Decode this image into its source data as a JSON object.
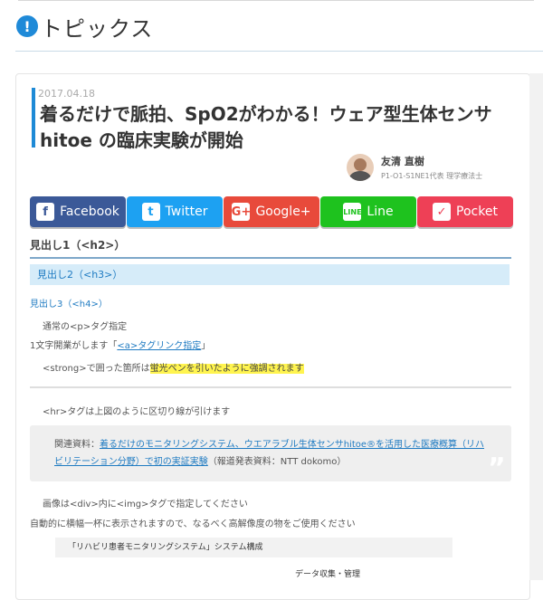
{
  "section": {
    "icon": "exclamation-icon",
    "icon_glyph": "!",
    "title": "トピックス"
  },
  "article": {
    "date": "2017.04.18",
    "title": "着るだけで脈拍、SpO2がわかる！ウェア型生体センサhitoe の臨床実験が開始",
    "author": {
      "name": "友清 直樹",
      "role": "P1-O1-S1NE1代表 理学療法士"
    }
  },
  "share": [
    {
      "label": "Facebook",
      "icon": "facebook-icon",
      "glyph": "f"
    },
    {
      "label": "Twitter",
      "icon": "twitter-icon",
      "glyph": "t"
    },
    {
      "label": "Google+",
      "icon": "google-plus-icon",
      "glyph": "G+"
    },
    {
      "label": "Line",
      "icon": "line-icon",
      "glyph": "LINE"
    },
    {
      "label": "Pocket",
      "icon": "pocket-icon",
      "glyph": "✓"
    }
  ],
  "body": {
    "h2": "見出し1（<h2>）",
    "h3": "見出し2（<h3>）",
    "h4": "見出し3（<h4>）",
    "p1": "通常の<p>タグ指定",
    "p2_prefix": "1文字開業がします「",
    "p2_link": "<a>タグリンク指定",
    "p2_suffix": "」",
    "p3_prefix": "<strong>で囲った箇所は",
    "p3_mark": "蛍光ペンを引いたように強調されます",
    "p4": "<hr>タグは上図のように区切り線が引けます",
    "quote_prefix": "関連資料：",
    "quote_link": "着るだけのモニタリングシステム、ウエアラブル生体センサhitoe®を活用した医療概算（リハビリテーション分野）で初の実証実験",
    "quote_suffix": "（報道発表資料：NTT dokomo）",
    "quote_mark": "”",
    "p5": "画像は<div>内に<img>タグで指定してください",
    "p6": "自動的に横幅一杯に表示されますので、なるべく高解像度の物をご使用ください",
    "figure_caption": "「リハビリ患者モニタリングシステム」システム構成",
    "figure_sub": "データ収集・管理"
  },
  "colors": {
    "accent": "#1e8ad6",
    "facebook": "#3b5998",
    "twitter": "#1da1f2",
    "google": "#e84a3b",
    "line": "#1ec21e",
    "pocket": "#ee4056",
    "highlight": "#fff44f"
  }
}
